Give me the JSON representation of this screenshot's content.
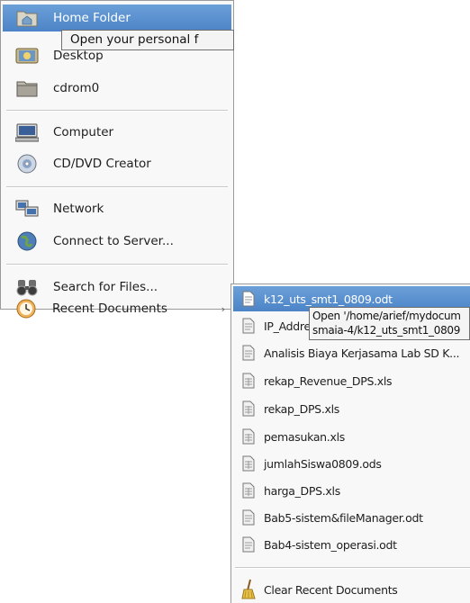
{
  "places_menu": {
    "items": [
      {
        "label": "Home Folder",
        "icon": "home-folder-icon",
        "selected": true
      },
      {
        "label": "Desktop",
        "icon": "desktop-icon"
      },
      {
        "label": "cdrom0",
        "icon": "folder-icon"
      },
      {
        "label": "Computer",
        "icon": "computer-icon"
      },
      {
        "label": "CD/DVD Creator",
        "icon": "cd-icon"
      },
      {
        "label": "Network",
        "icon": "network-icon"
      },
      {
        "label": "Connect to Server...",
        "icon": "globe-icon"
      },
      {
        "label": "Search for Files...",
        "icon": "binoculars-icon"
      },
      {
        "label": "Recent Documents",
        "icon": "clock-icon",
        "submenu_arrow": "›"
      }
    ]
  },
  "home_tooltip": {
    "text": "Open your personal f"
  },
  "recent_menu": {
    "items": [
      {
        "label": "k12_uts_smt1_0809.odt",
        "selected": true
      },
      {
        "label": "IP_Addre"
      },
      {
        "label": "Analisis Biaya Kerjasama Lab SD K..."
      },
      {
        "label": "rekap_Revenue_DPS.xls"
      },
      {
        "label": "rekap_DPS.xls"
      },
      {
        "label": "pemasukan.xls"
      },
      {
        "label": "jumlahSiswa0809.ods"
      },
      {
        "label": "harga_DPS.xls"
      },
      {
        "label": "Bab5-sistem&fileManager.odt"
      },
      {
        "label": "Bab4-sistem_operasi.odt"
      }
    ],
    "clear_label": "Clear Recent Documents"
  },
  "recent_tooltip": {
    "line1": "Open '/home/arief/mydocum",
    "line2": "smaia-4/k12_uts_smt1_0809"
  },
  "colors": {
    "selection": "#5a8fd0",
    "menu_bg": "#f8f8f8",
    "tooltip_bg": "#f4f4f4"
  }
}
